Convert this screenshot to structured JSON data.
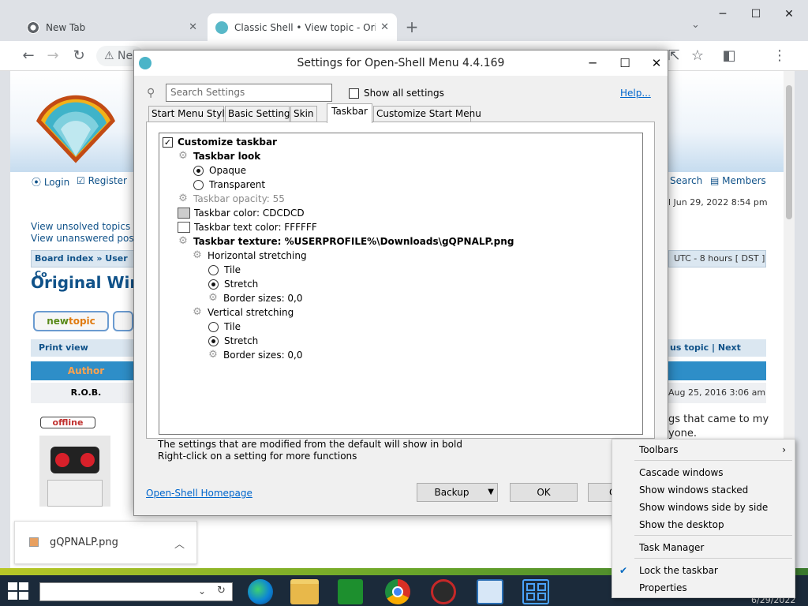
{
  "browser": {
    "tabs": [
      {
        "title": "New Tab"
      },
      {
        "title": "Classic Shell • View topic - Origin"
      }
    ],
    "omnibox_text": "Ne",
    "new_tab": "+",
    "download": {
      "filename": "gQPNALP.png"
    }
  },
  "webpage": {
    "login": "Login",
    "register": "Register",
    "search": "Search",
    "members": "Members",
    "date": "l Jun 29, 2022 8:54 pm",
    "unsolved": "View unsolved topics",
    "unanswered": "View unanswered posts",
    "board_index": "Board index",
    "user_co": "User Co",
    "tz": "UTC - 8 hours [ DST ]",
    "heading": "Original Windo",
    "new_topic": "new",
    "new_topic_accent": "topic",
    "print_view": "Print view",
    "prev_next": "us topic",
    "next_topic": "Next topic",
    "author": "Author",
    "rob": "R.O.B.",
    "post_date": "Aug 25, 2016 3:06 am",
    "offline": "offline",
    "post_text1": "gs that came to my",
    "post_text2": "yone."
  },
  "dialog": {
    "title": "Settings for Open-Shell Menu 4.4.169",
    "search_placeholder": "Search Settings",
    "show_all": "Show all settings",
    "help": "Help...",
    "tabs": [
      "Start Menu Style",
      "Basic Settings",
      "Skin",
      "Taskbar",
      "Customize Start Menu"
    ],
    "tree": {
      "customize": "Customize taskbar",
      "look": "Taskbar look",
      "opaque": "Opaque",
      "transparent": "Transparent",
      "opacity": "Taskbar opacity: 55",
      "color": "Taskbar color: CDCDCD",
      "text_color": "Taskbar text color: FFFFFF",
      "texture": "Taskbar texture: %USERPROFILE%\\Downloads\\gQPNALP.png",
      "hstretch": "Horizontal stretching",
      "tile": "Tile",
      "stretch": "Stretch",
      "border": "Border sizes: 0,0",
      "vstretch": "Vertical stretching"
    },
    "info1": "The settings that are modified from the default will show in bold",
    "info2": "Right-click on a setting for more functions",
    "homepage": "Open-Shell Homepage",
    "backup": "Backup",
    "ok": "OK",
    "cancel": "C"
  },
  "colors": {
    "taskbar_color": "#CDCDCD",
    "taskbar_text_color": "#FFFFFF"
  },
  "context_menu": {
    "toolbars": "Toolbars",
    "cascade": "Cascade windows",
    "stacked": "Show windows stacked",
    "side_by_side": "Show windows side by side",
    "desktop": "Show the desktop",
    "task_manager": "Task Manager",
    "lock": "Lock the taskbar",
    "properties": "Properties"
  },
  "taskbar": {
    "clock_date": "6/29/2022"
  }
}
